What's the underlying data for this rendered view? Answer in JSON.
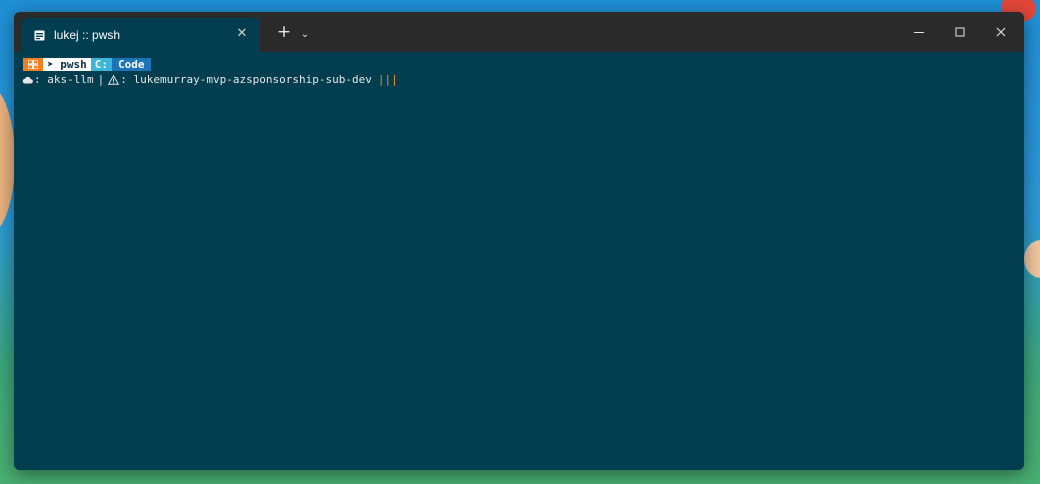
{
  "window": {
    "tab_title": "lukej :: pwsh",
    "tab_close_glyph": "✕",
    "new_tab_glyph": "+",
    "dropdown_glyph": "⌄"
  },
  "prompt": {
    "shell_segment": "➤ pwsh",
    "drive_segment": "C:",
    "path_segment": "Code",
    "kube_context_label": ": aks-llm",
    "separator": "|",
    "subscription_label": ": lukemurray-mvp-azsponsorship-sub-dev",
    "status_bars": "|||"
  },
  "colors": {
    "terminal_bg": "#023e4f",
    "titlebar_bg": "#2a2a2a",
    "os_segment": "#f07f1e",
    "shell_segment": "#ffffff",
    "drive_segment": "#3ab6d9",
    "path_segment": "#1b73b8",
    "status_bars": "#e79a1a"
  },
  "icons": {
    "tab": "terminal-icon",
    "os_segment": "windows-icon",
    "kube": "cloud-icon",
    "subscription": "warning-icon"
  }
}
